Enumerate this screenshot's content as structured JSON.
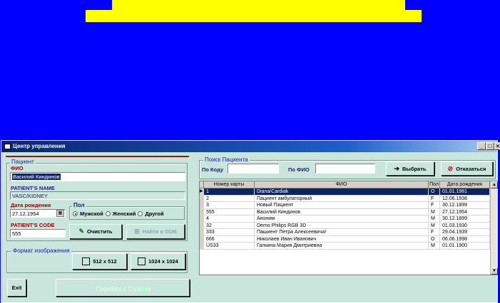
{
  "window": {
    "title": "Центр управления",
    "minimize": "_",
    "maximize": "□",
    "close": "×"
  },
  "patient": {
    "group_label": "Пациент",
    "fio_label": "ФИО",
    "fio_value": "Василий Киндинов",
    "patient_name_label": "PATIENT'S NAME",
    "patient_name_value": "VASC/KIDNEY",
    "dob_label": "Дата рождения",
    "dob_value": "27.12.1954",
    "sex_label": "Пол",
    "sex_options": [
      "Мужской",
      "Женский",
      "Другой"
    ],
    "sex_selected": "Мужской",
    "patient_code_label": "PATIENT'S CODE",
    "patient_code_value": "555",
    "clear_label": "Очистить",
    "find_gdb_label": "Найти в GDB"
  },
  "image_format": {
    "group_label": "Формат изображения",
    "opt1": "512 x 512",
    "opt2": "1024 x 1024"
  },
  "search": {
    "group_label": "Поиск Пациента",
    "by_code_label": "По Коду",
    "by_code_value": "",
    "by_fio_label": "По ФИО",
    "by_fio_value": "",
    "select_label": "Выбрать",
    "cancel_label": "Отказаться"
  },
  "table": {
    "columns": [
      "Номер карты",
      "ФИО",
      "Пол",
      "Дата рождения"
    ],
    "rows": [
      [
        "1",
        "Diana/Cardiak",
        "O",
        "01.01.1981"
      ],
      [
        "2",
        "Пациент амбулаторный",
        "F",
        "12.06.1938"
      ],
      [
        "3",
        "Новый Пациент",
        "F",
        "30.12.1899"
      ],
      [
        "555",
        "Василий Киндинов",
        "M",
        "27.12.1954"
      ],
      [
        "4",
        "Аноним",
        "M",
        "30.12.1899"
      ],
      [
        "32",
        "Demo Philips RGB 3D",
        "M",
        "01.03.1930"
      ],
      [
        "333",
        "Пашиент  Петра Алексеевича!",
        "F",
        "29.04.1939"
      ],
      [
        "666",
        "Николаев Иван Иванович",
        "O",
        "06.06.1998"
      ],
      [
        "US33",
        "Галкина Мария Дмитриевна",
        "M",
        "01.01.1900"
      ]
    ],
    "selected_row": 0
  },
  "footer": {
    "exit_label": "Exit",
    "go_label": "Перейти  к  Съемке"
  },
  "colors": {
    "desktop": "#0000ff",
    "banner": "#ffff00",
    "window_bg": "#c8e6dc",
    "selection": "#0a246a"
  }
}
